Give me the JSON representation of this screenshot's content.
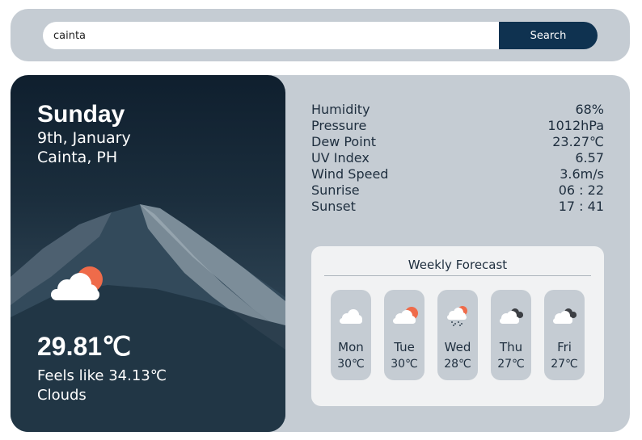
{
  "search": {
    "value": "cainta",
    "button_label": "Search"
  },
  "current": {
    "day": "Sunday",
    "date": "9th, January",
    "location": "Cainta, PH",
    "icon": "cloud-sun-icon",
    "temperature": "29.81℃",
    "feels_like": "Feels like 34.13℃",
    "condition": "Clouds"
  },
  "stats": [
    {
      "label": "Humidity",
      "value": "68%"
    },
    {
      "label": "Pressure",
      "value": "1012hPa"
    },
    {
      "label": "Dew Point",
      "value": "23.27℃"
    },
    {
      "label": "UV Index",
      "value": "6.57"
    },
    {
      "label": "Wind Speed",
      "value": "3.6m/s"
    },
    {
      "label": "Sunrise",
      "value": "06 : 22"
    },
    {
      "label": "Sunset",
      "value": "17 : 41"
    }
  ],
  "weekly": {
    "title": "Weekly Forecast",
    "days": [
      {
        "name": "Mon",
        "temp": "30℃",
        "icon": "cloud-icon"
      },
      {
        "name": "Tue",
        "temp": "30℃",
        "icon": "cloud-sun-icon"
      },
      {
        "name": "Wed",
        "temp": "28℃",
        "icon": "cloud-sun-rain-icon"
      },
      {
        "name": "Thu",
        "temp": "27℃",
        "icon": "dark-clouds-icon"
      },
      {
        "name": "Fri",
        "temp": "27℃",
        "icon": "dark-clouds-icon"
      }
    ]
  },
  "colors": {
    "panel": "#c5ccd3",
    "accent": "#0f3250",
    "sun": "#ef6b4a",
    "text": "#1e2e3e"
  }
}
